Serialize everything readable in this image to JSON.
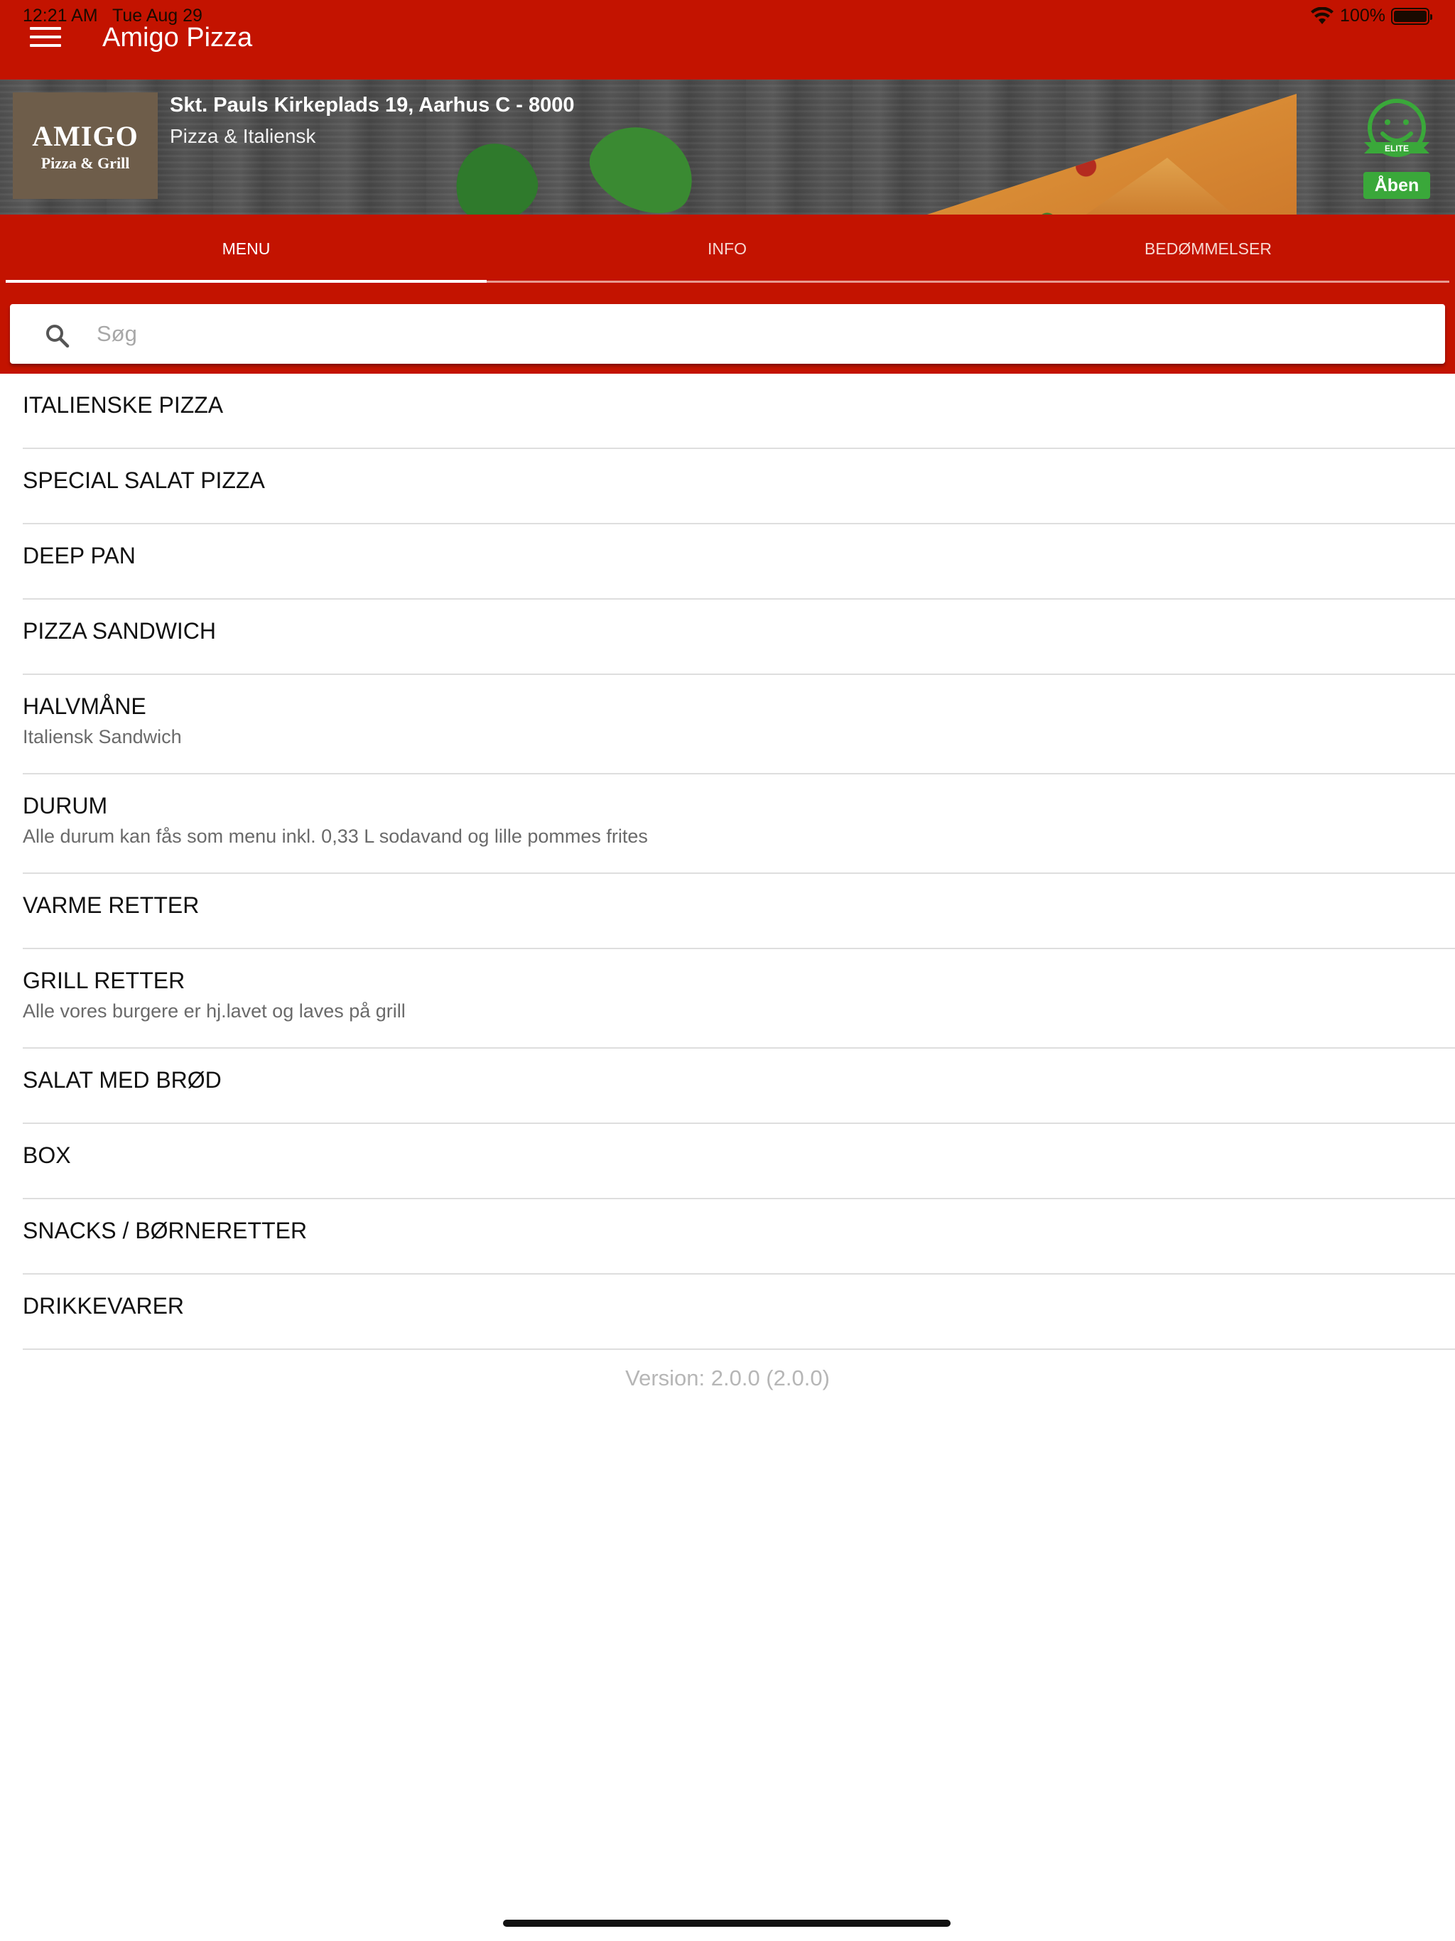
{
  "status_bar": {
    "time": "12:21 AM",
    "date": "Tue Aug 29",
    "battery": "100%"
  },
  "app_bar": {
    "title": "Amigo Pizza",
    "menu_icon": "hamburger-menu-icon",
    "color": "#c31300"
  },
  "restaurant": {
    "logo_line1": "AMIGO",
    "logo_line2": "Pizza & Grill",
    "address": "Skt. Pauls Kirkeplads 19, Aarhus C - 8000",
    "category": "Pizza & Italiensk",
    "elite_icon": "elite-smiley-icon",
    "elite_text": "ELITE",
    "open_status": "Åben",
    "open_color": "#3aa83a"
  },
  "tabs": [
    {
      "label": "MENU",
      "active": true
    },
    {
      "label": "INFO",
      "active": false
    },
    {
      "label": "BEDØMMELSER",
      "active": false
    }
  ],
  "search": {
    "placeholder": "Søg",
    "value": "",
    "icon": "search-icon"
  },
  "menu_categories": [
    {
      "title": "ITALIENSKE PIZZA",
      "subtitle": ""
    },
    {
      "title": "SPECIAL SALAT PIZZA",
      "subtitle": ""
    },
    {
      "title": "DEEP PAN",
      "subtitle": ""
    },
    {
      "title": "PIZZA SANDWICH",
      "subtitle": ""
    },
    {
      "title": "HALVMÅNE",
      "subtitle": "Italiensk Sandwich"
    },
    {
      "title": "DURUM",
      "subtitle": "Alle durum kan fås som menu inkl. 0,33 L sodavand og lille pommes frites"
    },
    {
      "title": "VARME RETTER",
      "subtitle": ""
    },
    {
      "title": "GRILL RETTER",
      "subtitle": "Alle vores burgere er hj.lavet og laves på grill"
    },
    {
      "title": "SALAT MED BRØD",
      "subtitle": ""
    },
    {
      "title": "BOX",
      "subtitle": ""
    },
    {
      "title": "SNACKS / BØRNERETTER",
      "subtitle": ""
    },
    {
      "title": "DRIKKEVARER",
      "subtitle": ""
    }
  ],
  "footer": {
    "version": "Version: 2.0.0 (2.0.0)"
  }
}
